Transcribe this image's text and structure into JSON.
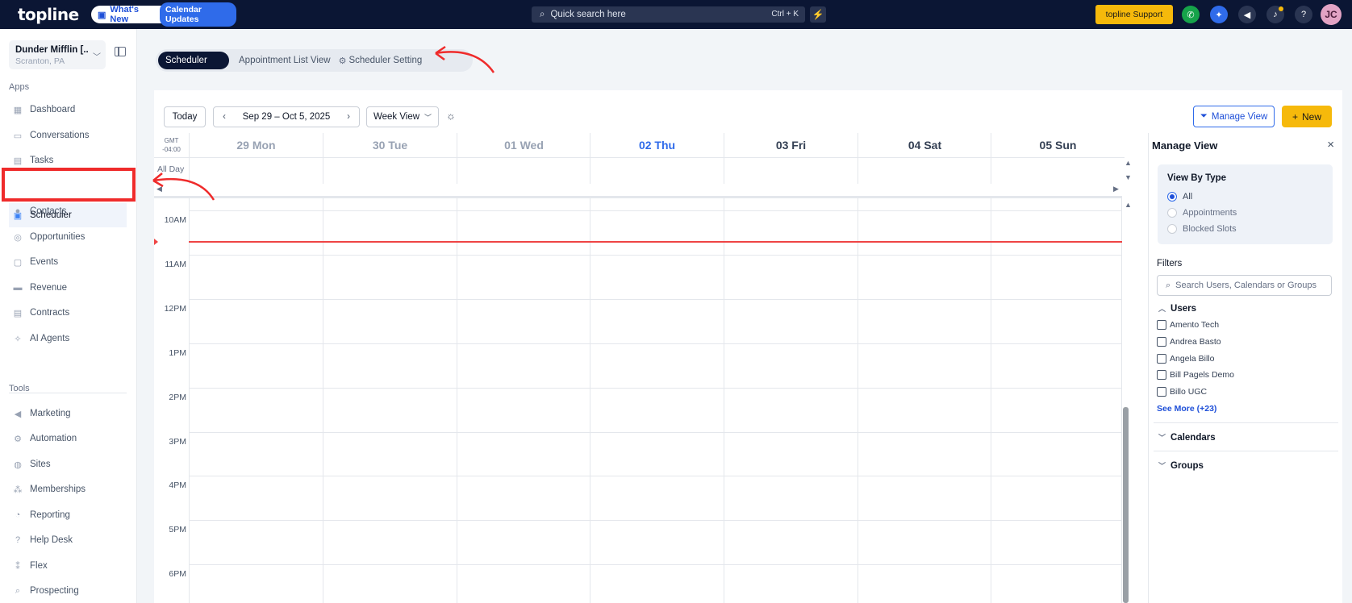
{
  "brand": {
    "logo": "topline"
  },
  "topbar": {
    "whats_new": "What's New",
    "calendar_updates": "Calendar Updates",
    "search_placeholder": "Quick search here",
    "search_shortcut": "Ctrl + K",
    "support_label": "topline Support",
    "avatar_initials": "JC"
  },
  "sidebar": {
    "location_name": "Dunder Mifflin [...",
    "location_city": "Scranton, PA",
    "apps_label": "Apps",
    "tools_label": "Tools",
    "apps": [
      {
        "label": "Dashboard",
        "icon": "dashboard-icon"
      },
      {
        "label": "Conversations",
        "icon": "chat-icon"
      },
      {
        "label": "Tasks",
        "icon": "task-icon"
      },
      {
        "label": "Scheduler",
        "icon": "calendar-icon",
        "active": true
      },
      {
        "label": "Contacts",
        "icon": "person-icon"
      },
      {
        "label": "Opportunities",
        "icon": "target-icon"
      },
      {
        "label": "Events",
        "icon": "event-icon"
      },
      {
        "label": "Revenue",
        "icon": "card-icon"
      },
      {
        "label": "Contracts",
        "icon": "document-icon"
      },
      {
        "label": "AI Agents",
        "icon": "sparkle-icon"
      }
    ],
    "tools": [
      {
        "label": "Marketing",
        "icon": "megaphone-icon"
      },
      {
        "label": "Automation",
        "icon": "gear-icon"
      },
      {
        "label": "Sites",
        "icon": "globe-icon"
      },
      {
        "label": "Memberships",
        "icon": "group-icon"
      },
      {
        "label": "Reporting",
        "icon": "pie-icon"
      },
      {
        "label": "Help Desk",
        "icon": "help-icon"
      },
      {
        "label": "Flex",
        "icon": "people-icon"
      },
      {
        "label": "Prospecting",
        "icon": "search-icon"
      }
    ]
  },
  "subnav": {
    "active_tab": "Scheduler",
    "tab_list": "Appointment List View",
    "tab_setting": "Scheduler Setting"
  },
  "toolbar": {
    "today": "Today",
    "date_range": "Sep 29 – Oct 5, 2025",
    "view": "Week View",
    "manage_view": "Manage View",
    "new": "New"
  },
  "calendar": {
    "tz_line1": "GMT",
    "tz_line2": "-04:00",
    "all_day": "All Day",
    "days": [
      {
        "label": "29 Mon",
        "state": "past"
      },
      {
        "label": "30 Tue",
        "state": "past"
      },
      {
        "label": "01 Wed",
        "state": "past"
      },
      {
        "label": "02 Thu",
        "state": "today"
      },
      {
        "label": "03 Fri",
        "state": "future"
      },
      {
        "label": "04 Sat",
        "state": "future"
      },
      {
        "label": "05 Sun",
        "state": "future"
      }
    ],
    "hours": [
      "10AM",
      "11AM",
      "12PM",
      "1PM",
      "2PM",
      "3PM",
      "4PM",
      "5PM",
      "6PM"
    ]
  },
  "manage_view": {
    "title": "Manage View",
    "view_by_type": "View By Type",
    "options": [
      "All",
      "Appointments",
      "Blocked Slots"
    ],
    "selected": "All",
    "filters_label": "Filters",
    "filters_placeholder": "Search Users, Calendars or Groups",
    "users_label": "Users",
    "users": [
      "Amento Tech",
      "Andrea Basto",
      "Angela Billo",
      "Bill Pagels Demo",
      "Billo UGC"
    ],
    "see_more": "See More (+23)",
    "calendars_label": "Calendars",
    "groups_label": "Groups"
  },
  "colors": {
    "topbar": "#0b1634",
    "accent": "#2f6bea",
    "today": "#2f6bea",
    "warning": "#f6b90b",
    "annotation": "#ef2b2b"
  }
}
